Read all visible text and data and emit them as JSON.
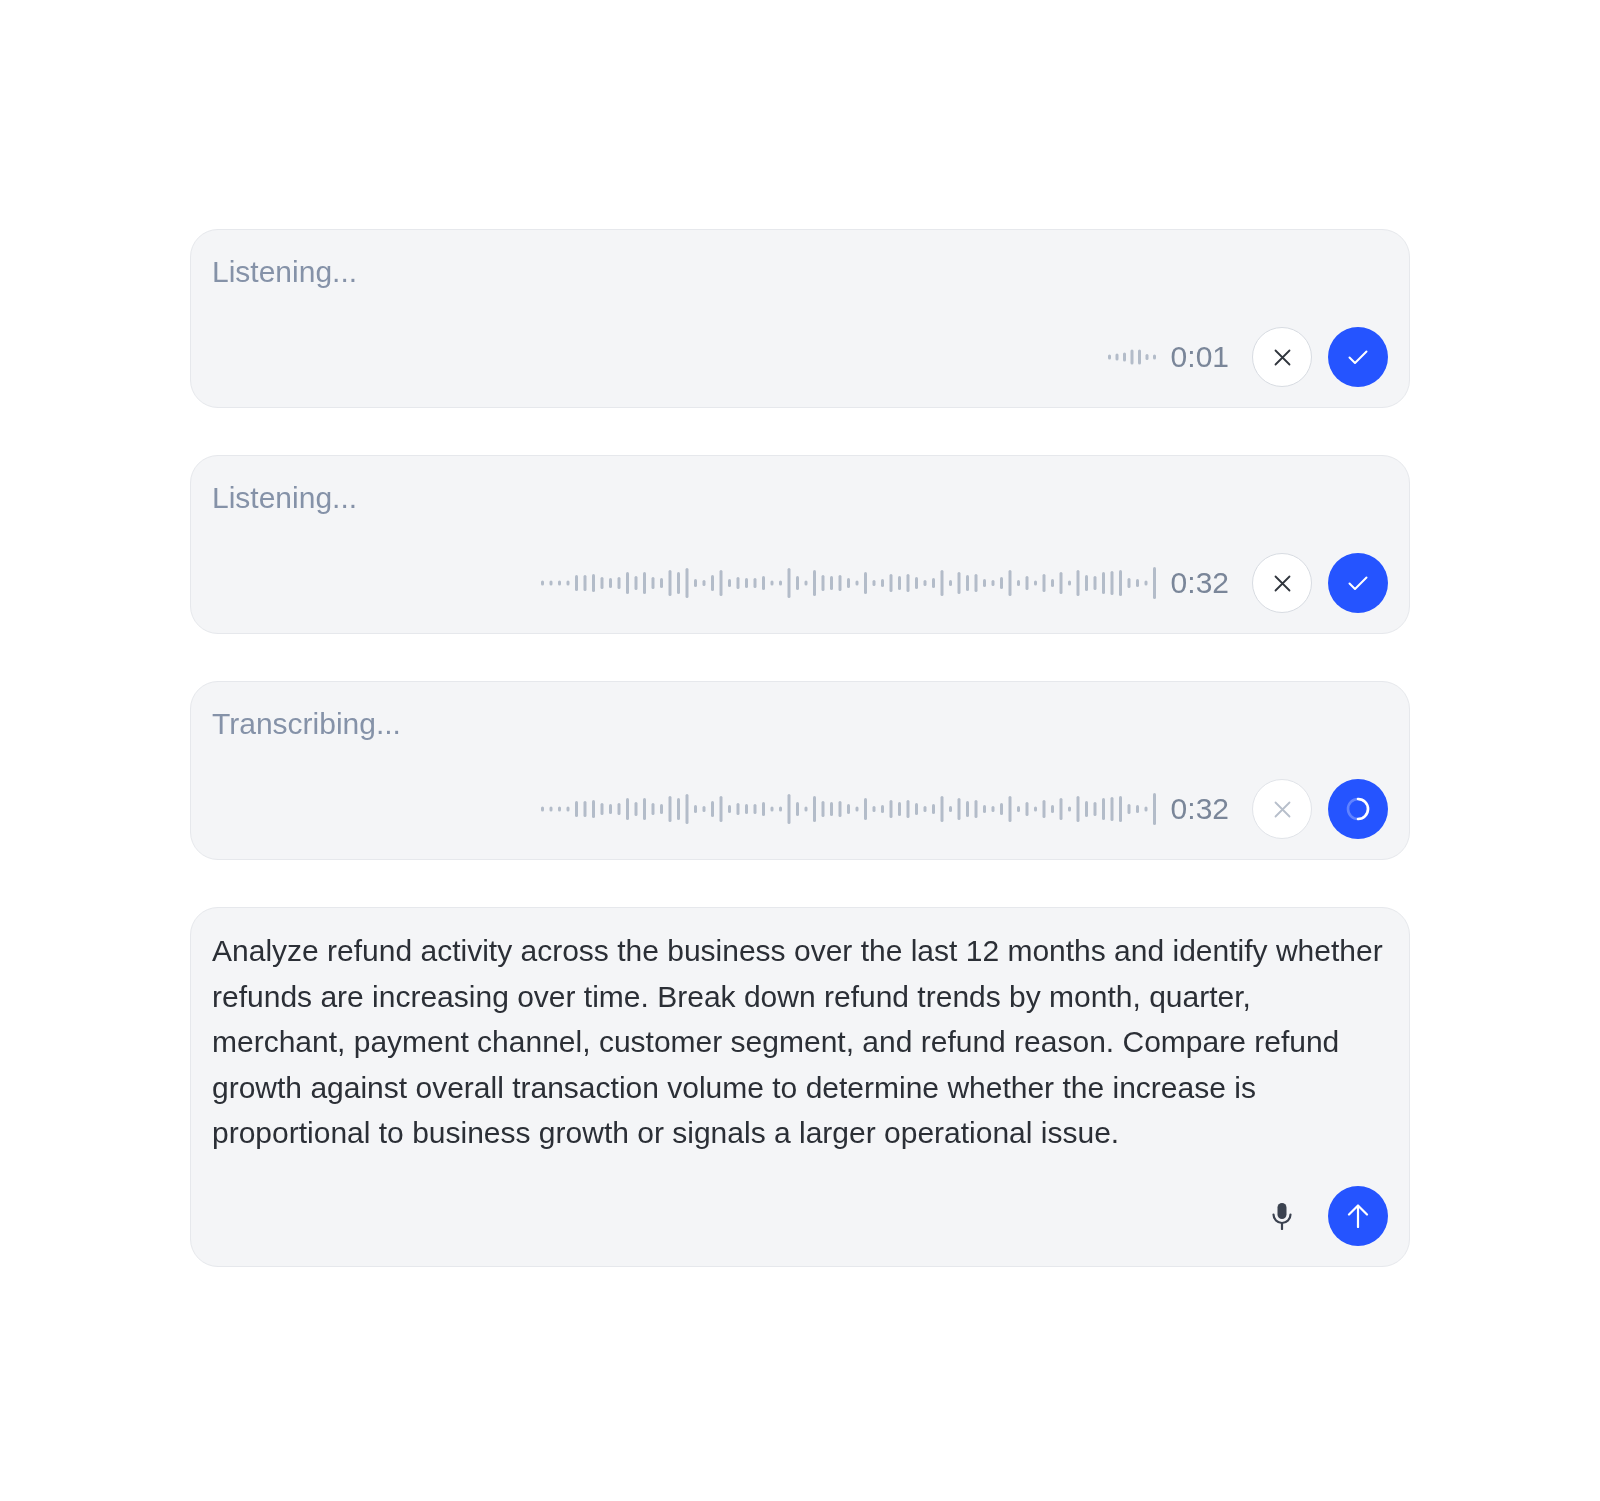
{
  "composers": [
    {
      "kind": "recording",
      "placeholder": "Listening...",
      "waveform": {
        "kind": "short"
      },
      "timer": "0:01",
      "cancel_disabled": false,
      "loading": false
    },
    {
      "kind": "recording",
      "placeholder": "Listening...",
      "waveform": {
        "kind": "long"
      },
      "timer": "0:32",
      "cancel_disabled": false,
      "loading": false
    },
    {
      "kind": "recording",
      "placeholder": "Transcribing...",
      "waveform": {
        "kind": "long"
      },
      "timer": "0:32",
      "cancel_disabled": true,
      "loading": true
    },
    {
      "kind": "text",
      "value": "Analyze refund activity across the business over the last 12 months and identify whether refunds are increasing over time. Break down refund trends by month, quarter, merchant, payment channel, customer segment, and refund reason. Compare refund growth against overall transaction volume to determine whether the increase is proportional to business growth or signals a larger operational issue."
    }
  ]
}
